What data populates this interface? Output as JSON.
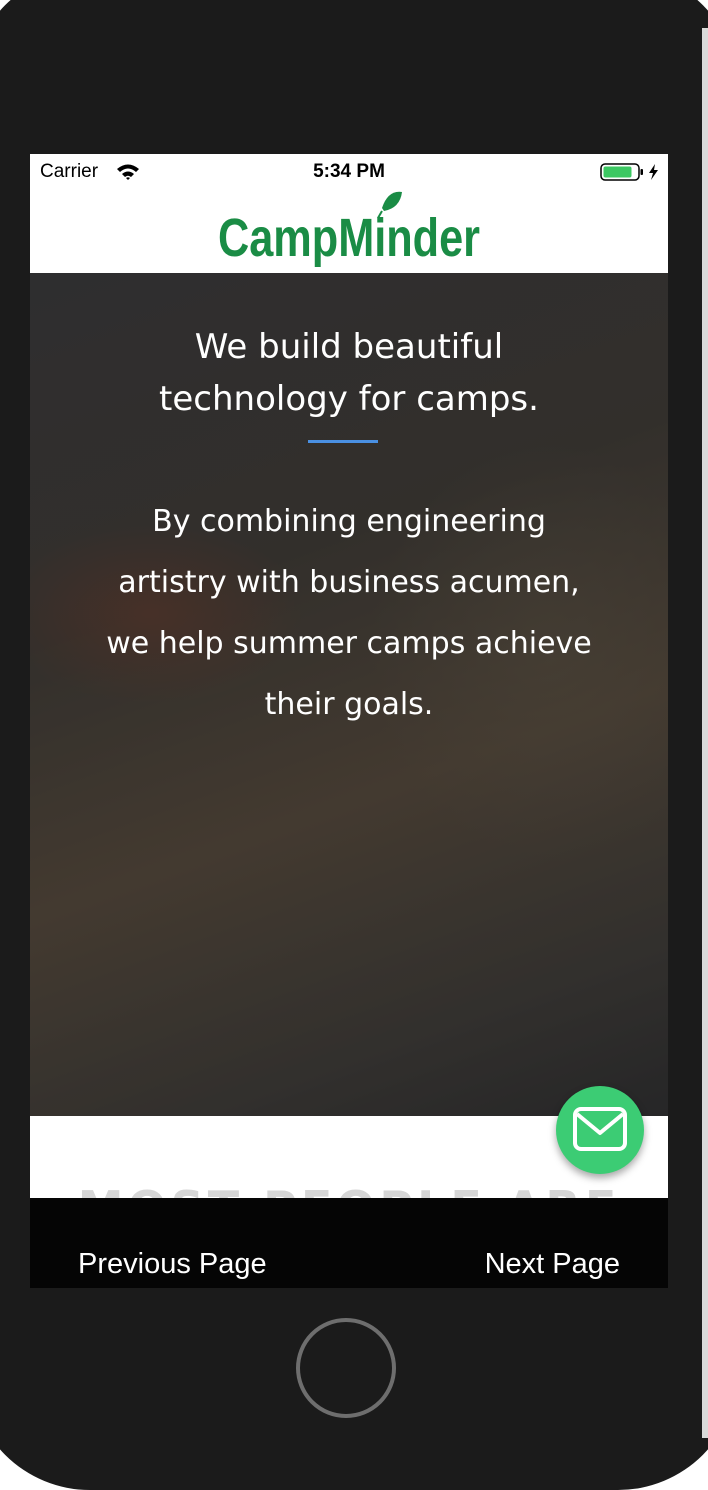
{
  "status_bar": {
    "carrier": "Carrier",
    "time": "5:34 PM",
    "wifi_icon": "wifi-icon",
    "battery_icon": "battery-charging-icon"
  },
  "header": {
    "logo_text": "CampMinder",
    "brand_color": "#1a8c45"
  },
  "hero": {
    "headline": "We build beautiful\ntechnology for camps.",
    "divider_color": "#4a90e2",
    "body": "By combining engineering\nartistry with business acumen,\nwe help summer camps achieve\ntheir goals."
  },
  "next_section": {
    "heading_partial": "MOST PEOPLE ARE"
  },
  "fab": {
    "icon": "envelope-icon",
    "color": "#3ccc74"
  },
  "nav": {
    "previous_label": "Previous Page",
    "next_label": "Next Page"
  }
}
